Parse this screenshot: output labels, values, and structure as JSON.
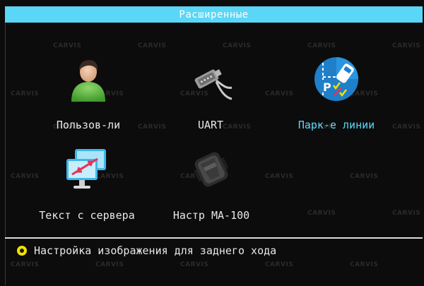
{
  "title": "Расширенные",
  "watermark": "CARVIS",
  "menu": [
    {
      "label": "Пользов-ли",
      "icon": "user-icon",
      "selected": false
    },
    {
      "label": "UART",
      "icon": "serial-cable-icon",
      "selected": false
    },
    {
      "label": "Парк-е линии",
      "icon": "parking-lines-icon",
      "selected": true
    },
    {
      "label": "Текст с сервера",
      "icon": "server-text-icon",
      "selected": false
    },
    {
      "label": "Настр MA-100",
      "icon": "ma100-device-icon",
      "selected": false
    }
  ],
  "status": {
    "text": "Настройка изображения для заднего хода"
  },
  "colors": {
    "accent": "#5ad6f6",
    "bullet": "#f2e100",
    "background": "#0c0c0c"
  }
}
